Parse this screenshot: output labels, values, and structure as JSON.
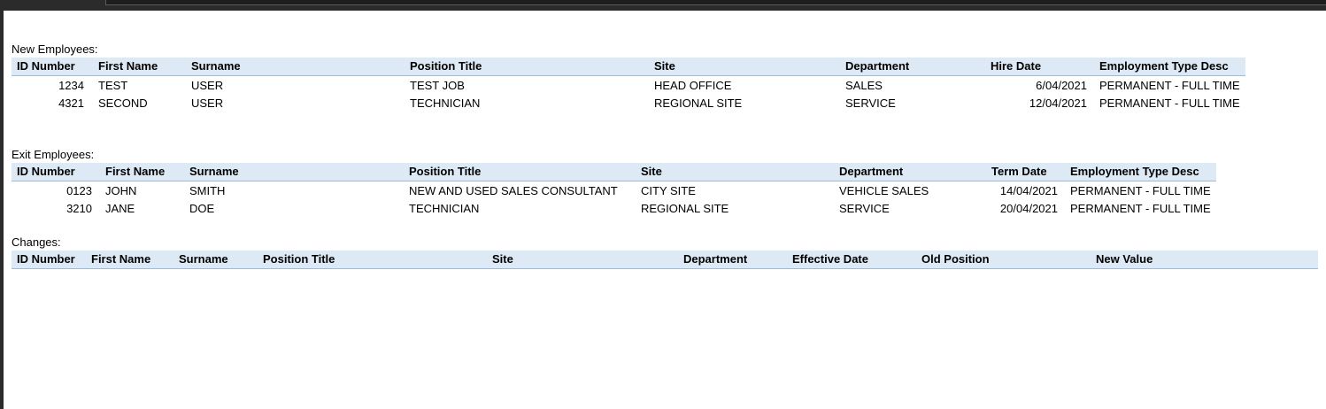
{
  "new_employees": {
    "title": "New Employees:",
    "columns": [
      "ID Number",
      "First Name",
      "Surname",
      "Position Title",
      "Site",
      "Department",
      "Hire Date",
      "Employment Type Desc"
    ],
    "rows": [
      [
        "1234",
        "TEST",
        "USER",
        "TEST JOB",
        "HEAD OFFICE",
        "SALES",
        "6/04/2021",
        "PERMANENT - FULL TIME"
      ],
      [
        "4321",
        "SECOND",
        "USER",
        "TECHNICIAN",
        "REGIONAL SITE",
        "SERVICE",
        "12/04/2021",
        "PERMANENT - FULL TIME"
      ]
    ]
  },
  "exit_employees": {
    "title": "Exit Employees:",
    "columns": [
      "ID Number",
      "First Name",
      "Surname",
      "Position Title",
      "Site",
      "Department",
      "Term Date",
      "Employment Type Desc"
    ],
    "rows": [
      [
        "0123",
        "JOHN",
        "SMITH",
        "NEW AND USED SALES CONSULTANT",
        "CITY SITE",
        "VEHICLE SALES",
        "14/04/2021",
        "PERMANENT - FULL TIME"
      ],
      [
        "3210",
        "JANE",
        "DOE",
        "TECHNICIAN",
        "REGIONAL SITE",
        "SERVICE",
        "20/04/2021",
        "PERMANENT - FULL TIME"
      ]
    ]
  },
  "changes": {
    "title": "Changes:",
    "columns": [
      "ID Number",
      "First Name",
      "Surname",
      "Position Title",
      "Site",
      "Department",
      "Effective Date",
      "Old Position",
      "New Value"
    ]
  }
}
